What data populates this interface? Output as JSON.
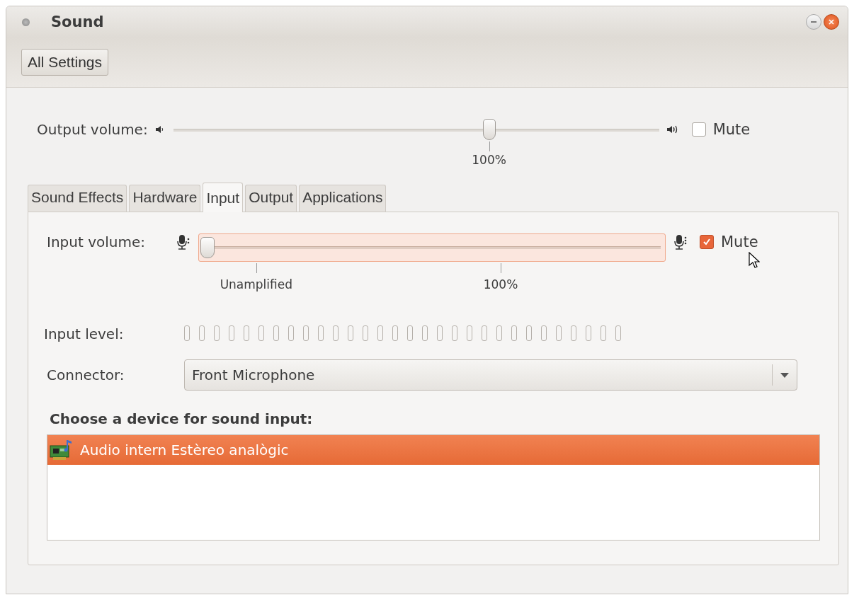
{
  "window": {
    "title": "Sound"
  },
  "toolbar": {
    "button": "All Settings"
  },
  "output_volume": {
    "label": "Output volume:",
    "level": 0.65,
    "tick_label": "100%",
    "mute": {
      "label": "Mute",
      "checked": false
    }
  },
  "tabs": [
    {
      "label": "Sound Effects",
      "selected": false
    },
    {
      "label": "Hardware",
      "selected": false
    },
    {
      "label": "Input",
      "selected": true
    },
    {
      "label": "Output",
      "selected": false
    },
    {
      "label": "Applications",
      "selected": false
    }
  ],
  "input_volume": {
    "label": "Input volume:",
    "level": 0.0,
    "ticks": [
      {
        "label": "Unamplified"
      },
      {
        "label": "100%"
      }
    ],
    "mute": {
      "label": "Mute",
      "checked": true
    }
  },
  "input_level": {
    "label": "Input level:"
  },
  "connector": {
    "label": "Connector:",
    "value": "Front Microphone"
  },
  "device_list": {
    "heading": "Choose a device for sound input:",
    "items": [
      {
        "name": "Audio intern Estèreo analògic",
        "selected": true
      }
    ]
  }
}
